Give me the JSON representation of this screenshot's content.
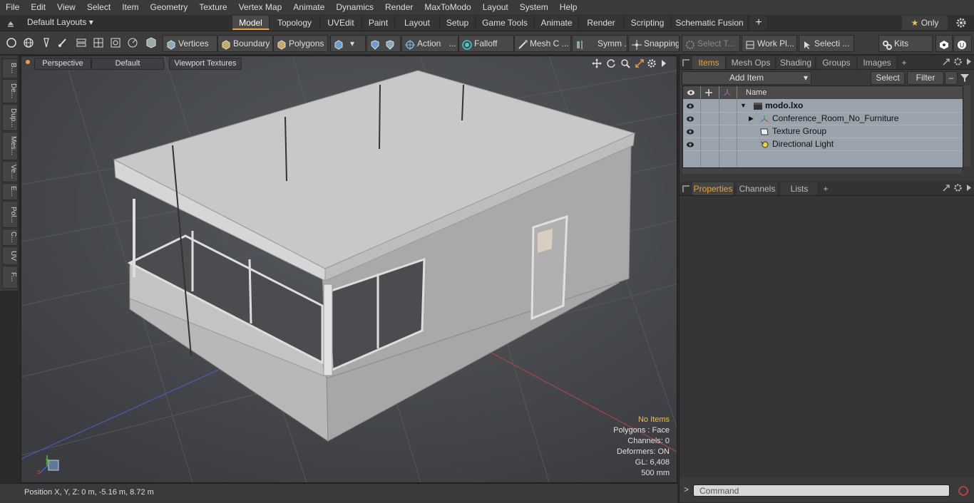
{
  "menu": [
    "File",
    "Edit",
    "View",
    "Select",
    "Item",
    "Geometry",
    "Texture",
    "Vertex Map",
    "Animate",
    "Dynamics",
    "Render",
    "MaxToModo",
    "Layout",
    "System",
    "Help"
  ],
  "layout_bar": {
    "layouts_label": "Default Layouts",
    "tabs": [
      "Model",
      "Topology",
      "UVEdit",
      "Paint",
      "Layout",
      "Setup",
      "Game Tools",
      "Animate",
      "Render",
      "Scripting",
      "Schematic Fusion"
    ],
    "active_tab": "Model",
    "only_label": "Only"
  },
  "toolbar": {
    "vertices": "Vertices",
    "boundary": "Boundary",
    "polygons": "Polygons",
    "action": "Action",
    "action_more": "...",
    "falloff": "Falloff",
    "mesh": "Mesh C ...",
    "symm": "Symm ...",
    "snapping": "Snapping",
    "select_t": "Select T...",
    "work_pl": "Work Pl...",
    "selecti": "Selecti ...",
    "kits": "Kits"
  },
  "left_tabs": [
    "B...",
    "De...",
    "Dup...",
    "Mes...",
    "Ve...",
    "E...",
    "Pol...",
    "C...",
    "UV",
    "F..."
  ],
  "viewport": {
    "perspective": "Perspective",
    "default": "Default",
    "viewport_textures": "Viewport Textures",
    "info": {
      "no_items": "No Items",
      "polygons": "Polygons : Face",
      "channels": "Channels: 0",
      "deformers": "Deformers: ON",
      "gl": "GL: 6,408",
      "scale": "500 mm"
    }
  },
  "status": {
    "position": "Position X, Y, Z:   0 m, -5.16 m, 8.72 m"
  },
  "items_panel": {
    "tabs": [
      "Items",
      "Mesh Ops",
      "Shading",
      "Groups",
      "Images"
    ],
    "active_tab": "Items",
    "add_item": "Add Item",
    "select": "Select",
    "filter": "Filter",
    "name_col": "Name",
    "rows": [
      {
        "label": "modo.lxo"
      },
      {
        "label": "Conference_Room_No_Furniture"
      },
      {
        "label": "Texture Group"
      },
      {
        "label": "Directional Light"
      }
    ]
  },
  "properties_panel": {
    "tabs": [
      "Properties",
      "Channels",
      "Lists"
    ],
    "active_tab": "Properties"
  },
  "command": {
    "prompt": ">",
    "placeholder": "Command"
  },
  "colors": {
    "accent": "#e8a33a",
    "viewport_bg": "#4a4d52",
    "item_list_bg": "#9aa3ab",
    "info_warning": "#f0c040"
  }
}
